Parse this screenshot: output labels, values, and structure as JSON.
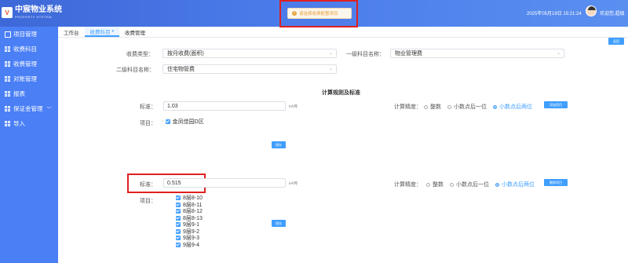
{
  "header": {
    "logo_mark": "V",
    "app_name": "中宸物业系统",
    "app_sub": "PROPERTY SYSTEM",
    "datetime": "2025年05月19日 15:21:24",
    "welcome": "欢迎您,超级"
  },
  "toast": {
    "icon": "!",
    "message": "请选择收费配置项目"
  },
  "sidebar": {
    "items": [
      {
        "label": "项目管理",
        "icon": "list-icon"
      },
      {
        "label": "收费科目",
        "icon": "grid-icon"
      },
      {
        "label": "收费管理",
        "icon": "grid-icon"
      },
      {
        "label": "对账管理",
        "icon": "grid-icon"
      },
      {
        "label": "报表",
        "icon": "grid-icon"
      },
      {
        "label": "保证金管理",
        "icon": "grid-icon",
        "chevron": "﹀"
      },
      {
        "label": "导入",
        "icon": "grid-icon"
      }
    ]
  },
  "tabs": [
    {
      "label": "工作台",
      "active": false
    },
    {
      "label": "收费科目",
      "active": true,
      "arrow": "▾"
    },
    {
      "label": "收费管理",
      "active": false
    }
  ],
  "form": {
    "fee_type_label": "收费类型：",
    "fee_type_value": "按月收费(面积)",
    "level1_label": "一级科目名称：",
    "level1_value": "物业管理费",
    "level2_label": "二级科目名称：",
    "level2_value": "住宅物管费",
    "arrow": "⌄"
  },
  "section_title": "计算规则及标准",
  "rule1": {
    "standard_label": "标准：",
    "standard_value": "1.03",
    "unit": "m²/月",
    "precision_label": "计算精度：",
    "options": [
      "整数",
      "小数点后一位",
      "小数点后两位"
    ],
    "selected": 2,
    "add_button": "添加项目",
    "project_label": "项目：",
    "project_tree_toggle": "›",
    "project_checked": "金凤佳园D区",
    "save_button": "保存"
  },
  "rule2": {
    "standard_label": "标准：",
    "standard_value": "0.515",
    "unit": "m²/月",
    "precision_label": "计算精度：",
    "options": [
      "整数",
      "小数点后一位",
      "小数点后两位"
    ],
    "selected": 2,
    "delete_button": "删除项目",
    "project_label": "项目：",
    "projects": [
      "8层8-10",
      "8层8-11",
      "8层8-12",
      "8层8-13",
      "9层9-1",
      "9层9-2",
      "9层9-3",
      "9层9-4"
    ],
    "save_button": "保存"
  },
  "top_right_button": "返回",
  "colors": {
    "primary": "#409eff",
    "sidebar": "#4a7ff5",
    "header": "#3d68d8",
    "highlight": "#e02020",
    "warning": "#e6a23c"
  }
}
